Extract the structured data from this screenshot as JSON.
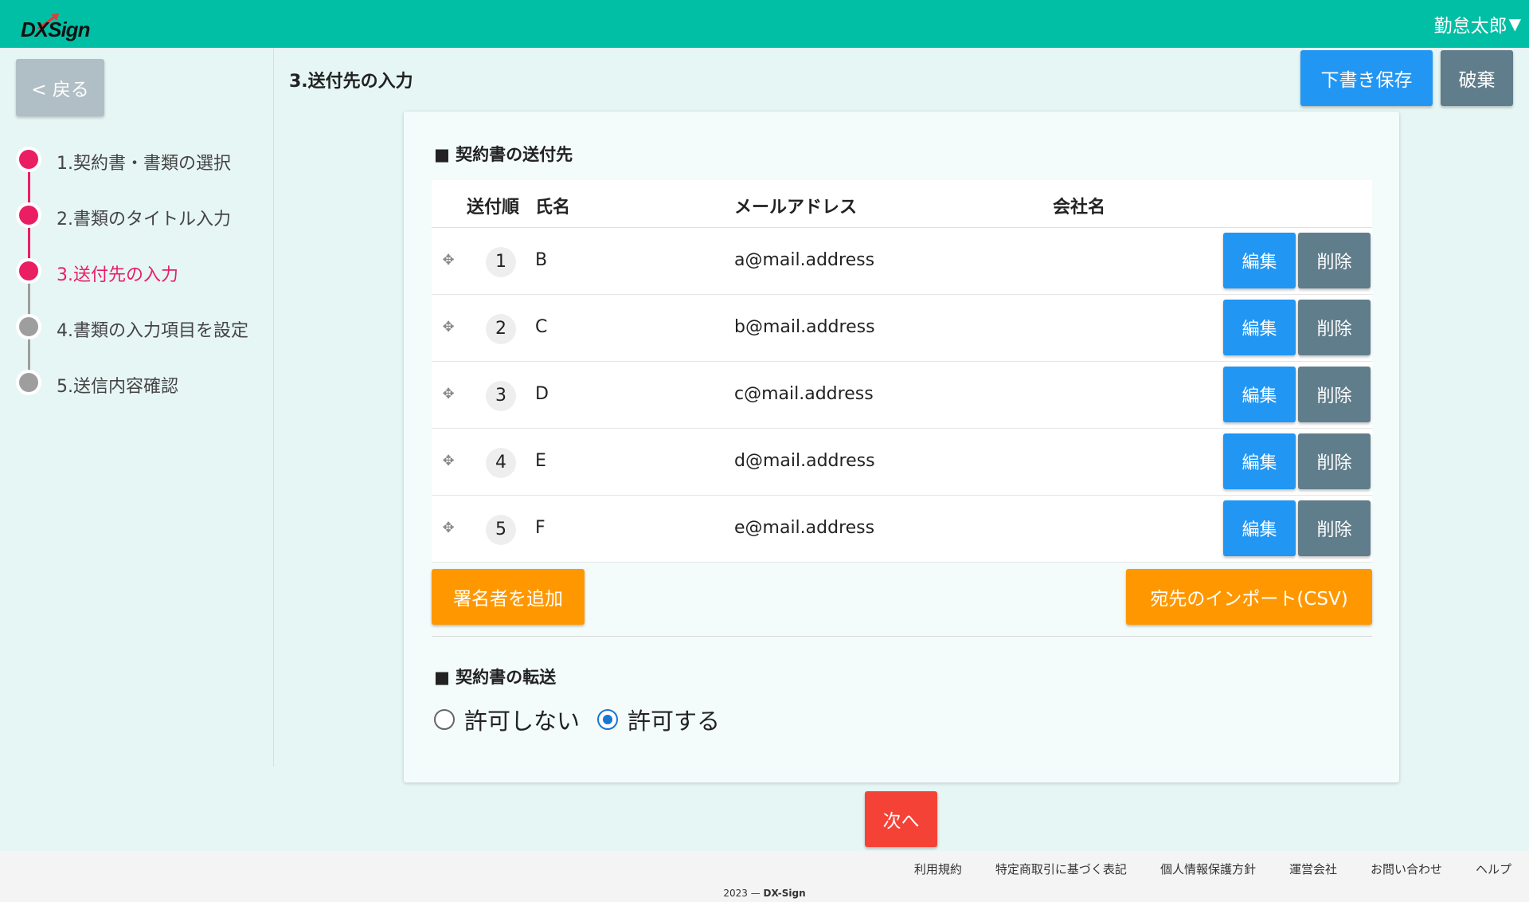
{
  "header": {
    "logo_text": "DXSign",
    "user_name": "勤怠太郎",
    "caret": "▼",
    "bg_color": "#00bfa5"
  },
  "sidebar": {
    "back_label": "< 戻る",
    "steps": [
      {
        "label": "1.契約書・書類の選択",
        "state": "done"
      },
      {
        "label": "2.書類のタイトル入力",
        "state": "done"
      },
      {
        "label": "3.送付先の入力",
        "state": "active"
      },
      {
        "label": "4.書類の入力項目を設定",
        "state": "pending"
      },
      {
        "label": "5.送信内容確認",
        "state": "pending"
      }
    ]
  },
  "page": {
    "title": "3.送付先の入力",
    "save_draft_label": "下書き保存",
    "discard_label": "破棄"
  },
  "recipients": {
    "section_title": "■ 契約書の送付先",
    "columns": {
      "order": "送付順",
      "name": "氏名",
      "email": "メールアドレス",
      "company": "会社名"
    },
    "rows": [
      {
        "order": "1",
        "name": "B",
        "email": "a@mail.address",
        "company": ""
      },
      {
        "order": "2",
        "name": "C",
        "email": "b@mail.address",
        "company": ""
      },
      {
        "order": "3",
        "name": "D",
        "email": "c@mail.address",
        "company": ""
      },
      {
        "order": "4",
        "name": "E",
        "email": "d@mail.address",
        "company": ""
      },
      {
        "order": "5",
        "name": "F",
        "email": "e@mail.address",
        "company": ""
      }
    ],
    "edit_label": "編集",
    "delete_label": "削除",
    "add_signer_label": "署名者を追加",
    "import_csv_label": "宛先のインポート(CSV)"
  },
  "transfer": {
    "section_title": "■ 契約書の転送",
    "options": [
      {
        "label": "許可しない",
        "checked": false
      },
      {
        "label": "許可する",
        "checked": true
      }
    ]
  },
  "next_label": "次へ",
  "footer": {
    "links": [
      "利用規約",
      "特定商取引に基づく表記",
      "個人情報保護方針",
      "運営会社",
      "お問い合わせ",
      "ヘルプ"
    ],
    "copyright_year": "2023 —",
    "copyright_brand": "DX-Sign"
  },
  "colors": {
    "accent_pink": "#e91e63",
    "step_pending": "#9e9e9e",
    "primary_blue": "#2196f3",
    "grey_button": "#607d8b",
    "orange_button": "#ff9800",
    "red_button": "#f44336"
  }
}
